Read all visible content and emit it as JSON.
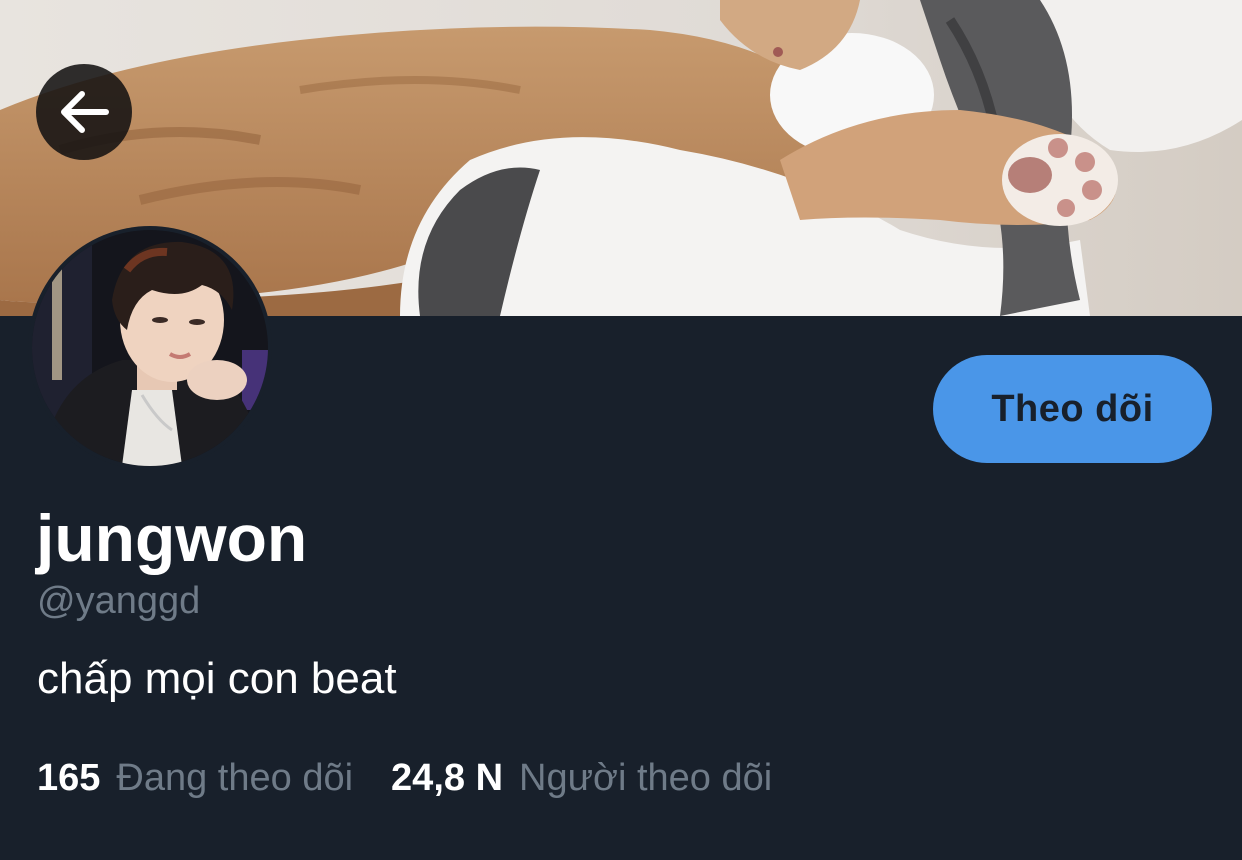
{
  "header": {
    "back_icon": "arrow-left-icon"
  },
  "profile": {
    "display_name": "jungwon",
    "handle": "@yanggd",
    "bio": "chấp mọi con beat",
    "follow_label": "Theo dõi"
  },
  "stats": {
    "following_count": "165",
    "following_label": "Đang theo dõi",
    "followers_count": "24,8 N",
    "followers_label": "Người theo dõi"
  },
  "colors": {
    "background": "#18202b",
    "accent": "#4a96e8",
    "muted_text": "#6f7b88",
    "primary_text": "#ffffff"
  }
}
